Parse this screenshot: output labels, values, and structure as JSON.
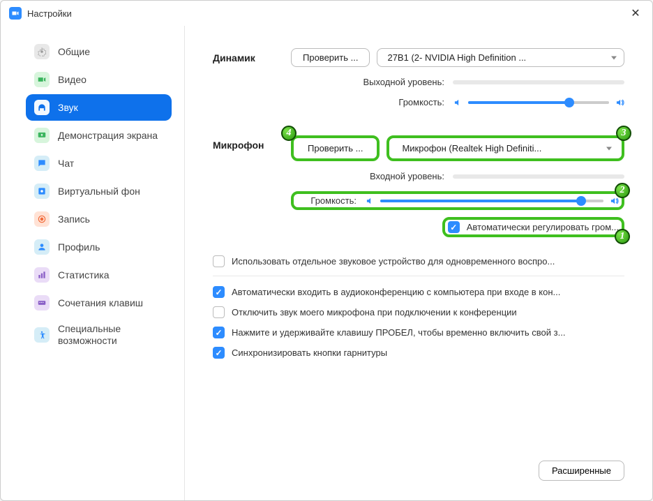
{
  "window": {
    "title": "Настройки"
  },
  "sidebar": {
    "items": [
      {
        "label": "Общие"
      },
      {
        "label": "Видео"
      },
      {
        "label": "Звук"
      },
      {
        "label": "Демонстрация экрана"
      },
      {
        "label": "Чат"
      },
      {
        "label": "Виртуальный фон"
      },
      {
        "label": "Запись"
      },
      {
        "label": "Профиль"
      },
      {
        "label": "Статистика"
      },
      {
        "label": "Сочетания клавиш"
      },
      {
        "label": "Специальные возможности"
      }
    ]
  },
  "speaker": {
    "section_label": "Динамик",
    "test_label": "Проверить ...",
    "device": "27B1 (2- NVIDIA High Definition ...",
    "output_level_label": "Выходной уровень:",
    "volume_label": "Громкость:",
    "volume_percent": 72
  },
  "mic": {
    "section_label": "Микрофон",
    "test_label": "Проверить ...",
    "device": "Микрофон (Realtek High Definiti...",
    "input_level_label": "Входной уровень:",
    "volume_label": "Громкость:",
    "volume_percent": 90,
    "auto_adjust_label": "Автоматически регулировать гром..."
  },
  "options": {
    "separate_device": "Использовать отдельное звуковое устройство для одновременного воспро...",
    "auto_join": "Автоматически входить в аудиоконференцию с компьютера при входе в кон...",
    "mute_on_join": "Отключить звук моего микрофона при подключении к конференции",
    "push_to_talk": "Нажмите и удерживайте клавишу ПРОБЕЛ, чтобы временно включить свой з...",
    "sync_headset": "Синхронизировать кнопки гарнитуры"
  },
  "advanced_label": "Расширенные",
  "badges": {
    "b1": "1",
    "b2": "2",
    "b3": "3",
    "b4": "4"
  }
}
